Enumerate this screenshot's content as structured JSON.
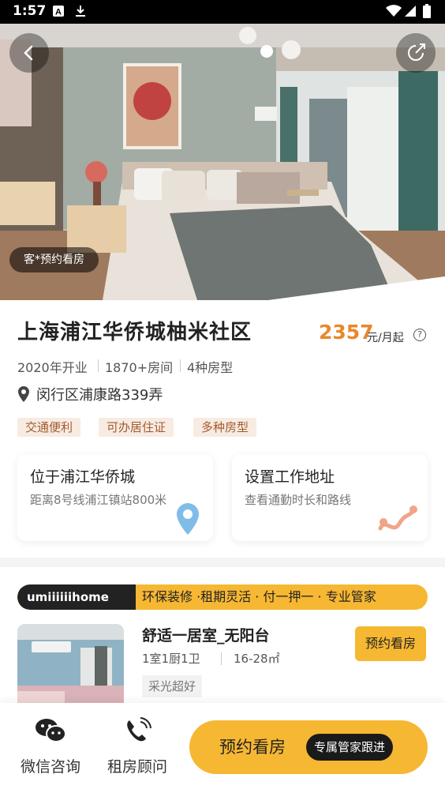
{
  "status_bar": {
    "time": "1:57",
    "icons": [
      "a-notification-icon",
      "download-icon",
      "wifi-icon",
      "signal-icon",
      "battery-icon"
    ]
  },
  "hero": {
    "tour_badge": "客*预约看房"
  },
  "community": {
    "name": "上海浦江华侨城柚米社区",
    "price": "2357",
    "price_unit": "元/月起",
    "meta": [
      "2020年开业",
      "1870+房间",
      "4种房型"
    ],
    "address": "闵行区浦康路339弄",
    "tags": [
      "交通便利",
      "可办居住证",
      "多种房型"
    ]
  },
  "cards": [
    {
      "title": "位于浦江华侨城",
      "subtitle": "距离8号线浦江镇站800米"
    },
    {
      "title": "设置工作地址",
      "subtitle": "查看通勤时长和路线"
    }
  ],
  "brand": {
    "logo": "umiiiiiihome",
    "slogan": "环保装修 ·租期灵活 · 付一押一 · 专业管家"
  },
  "room": {
    "name": "舒适一居室_无阳台",
    "layout": "1室1厨1卫",
    "area": "16-28㎡",
    "tag": "采光超好",
    "book_label": "预约看房"
  },
  "bottom_bar": {
    "wechat": "微信咨询",
    "advisor": "租房顾问",
    "cta": "预约看房",
    "cta_badge": "专属管家跟进"
  },
  "colors": {
    "accent": "#f6b733",
    "price": "#e8882a",
    "tag_bg": "#f7ebe2",
    "tag_text": "#a35b2e"
  }
}
